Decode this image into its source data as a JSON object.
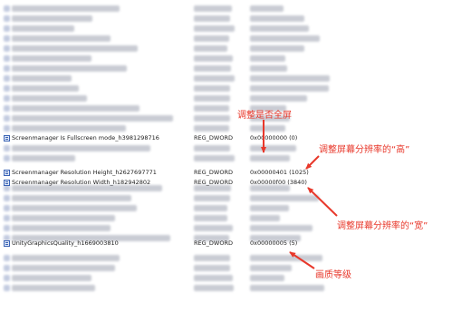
{
  "rows": [
    {
      "name": "Screenmanager Is Fullscreen mode_h3981298716",
      "type": "REG_DWORD",
      "data": "0x00000000 (0)",
      "icon": "registry-dword-icon"
    },
    {
      "name": "Screenmanager Resolution Height_h2627697771",
      "type": "REG_DWORD",
      "data": "0x00000401 (1025)",
      "icon": "registry-dword-icon"
    },
    {
      "name": "Screenmanager Resolution Width_h182942802",
      "type": "REG_DWORD",
      "data": "0x00000f00 (3840)",
      "icon": "registry-dword-icon"
    },
    {
      "name": "UnityGraphicsQuality_h1669003810",
      "type": "REG_DWORD",
      "data": "0x00000005 (5)",
      "icon": "registry-dword-icon"
    }
  ],
  "annotations": {
    "fullscreen": "调整是否全屏",
    "height": "调整屏幕分辨率的“高”",
    "width": "调整屏幕分辨率的“宽”",
    "quality": "画质等级"
  },
  "colors": {
    "annotation": "#e8382b",
    "blurred_text": "#c9ccd4"
  }
}
